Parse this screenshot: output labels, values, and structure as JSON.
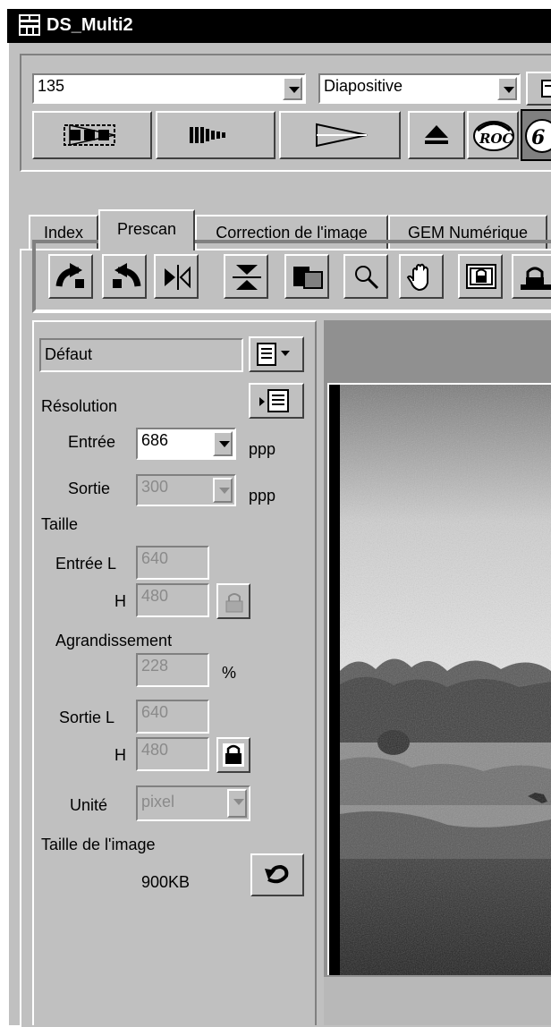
{
  "window": {
    "title": "DS_Multi2"
  },
  "film": {
    "format_value": "135",
    "type_value": "Diapositive"
  },
  "tabs": [
    "Index",
    "Prescan",
    "Correction de l'image",
    "GEM Numérique"
  ],
  "active_tab": "Prescan",
  "settings": {
    "preset_value": "Défaut",
    "resolution_label": "Résolution",
    "input_label": "Entrée",
    "input_value": "686",
    "input_unit": "ppp",
    "output_label": "Sortie",
    "output_value": "300",
    "output_unit": "ppp",
    "size_label": "Taille",
    "input_l_label": "Entrée L",
    "input_l_value": "640",
    "input_h_label": "H",
    "input_h_value": "480",
    "enlargement_label": "Agrandissement",
    "enlargement_value": "228",
    "enlargement_unit": "%",
    "output_l_label": "Sortie L",
    "output_l_value": "640",
    "output_h_label": "H",
    "output_h_value": "480",
    "unit_label": "Unité",
    "unit_value": "pixel",
    "image_size_label": "Taille de l'image",
    "image_size_value": "900KB"
  },
  "icons": {
    "scan_buttons": [
      "index-scan-icon",
      "prescan-icon",
      "scan-icon"
    ],
    "eject": "eject-icon",
    "roc": "ROC",
    "gem": "G",
    "toolbar": [
      "rotate-left-icon",
      "rotate-right-icon",
      "flip-horizontal-icon",
      "flip-vertical-icon",
      "crop-icon",
      "magnifier-icon",
      "hand-icon",
      "lock-icon",
      "lock-icon-2"
    ]
  }
}
